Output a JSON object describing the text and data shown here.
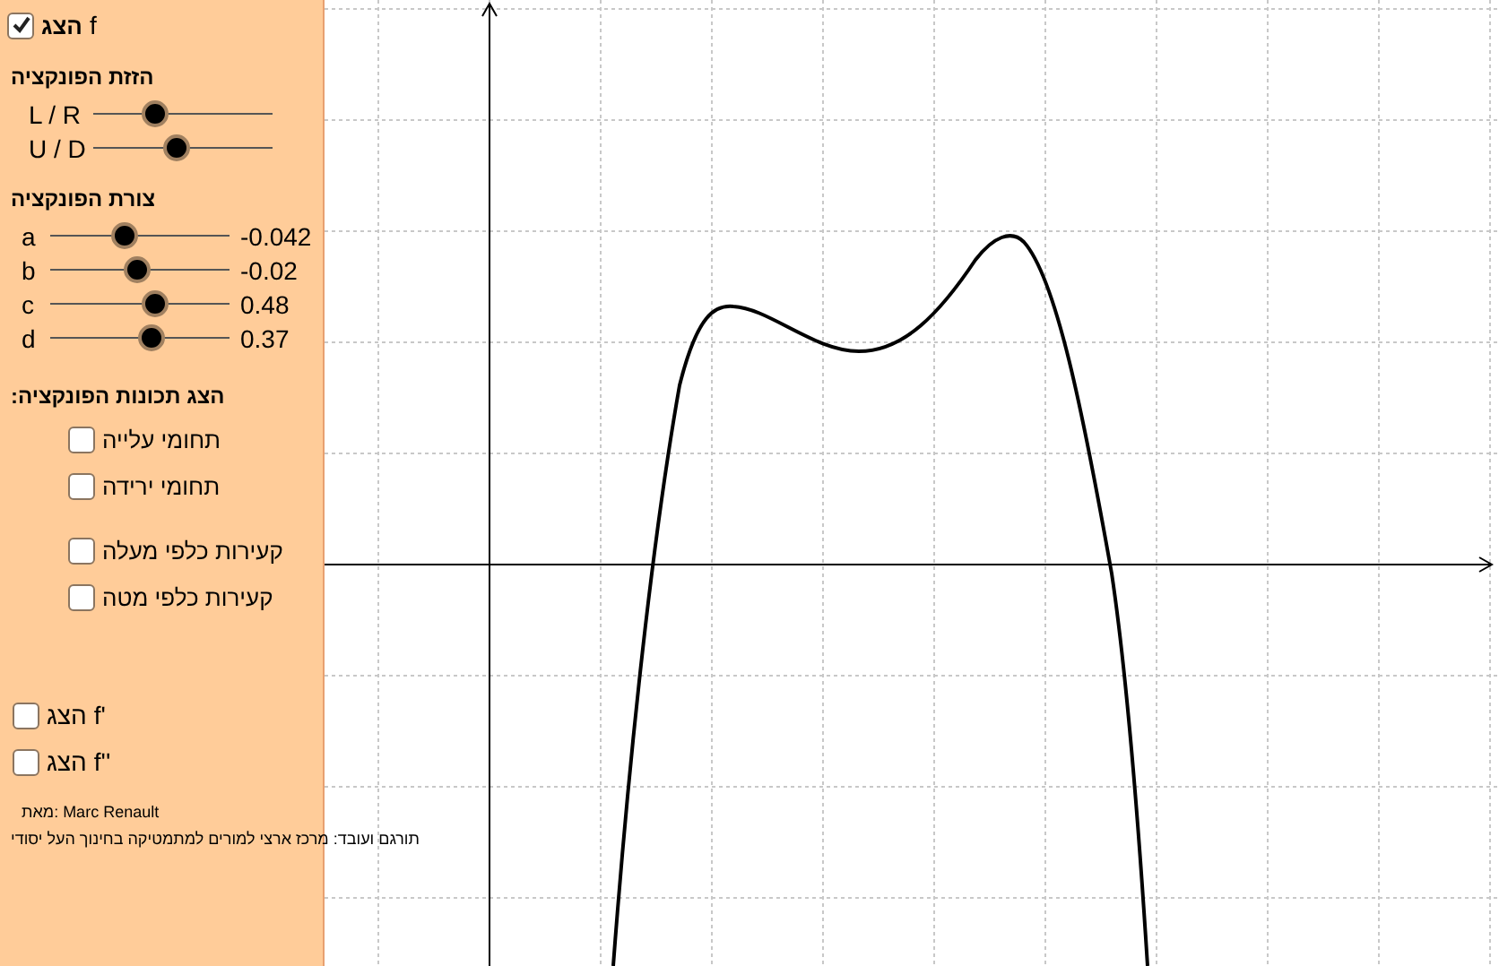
{
  "show_f": {
    "label": "הצג",
    "function": "f",
    "checked": true
  },
  "shift": {
    "title": "הזזת הפונקציה",
    "sliders": [
      {
        "label": "L / R",
        "level": 0.34
      },
      {
        "label": "U / D",
        "level": 0.46
      }
    ]
  },
  "shape": {
    "title": "צורת הפונקציה",
    "sliders": [
      {
        "label": "a",
        "level": 0.41,
        "reading": "-0.042"
      },
      {
        "label": "b",
        "level": 0.48,
        "reading": "-0.02"
      },
      {
        "label": "c",
        "level": 0.58,
        "reading": "0.48"
      },
      {
        "label": "d",
        "level": 0.56,
        "reading": "0.37"
      }
    ]
  },
  "properties": {
    "title": "הצג תכונות הפונקציה:",
    "options": [
      {
        "label": "תחומי עלייה",
        "checked": false
      },
      {
        "label": "תחומי ירידה",
        "checked": false
      },
      {
        "label": "קעירות כלפי מעלה",
        "checked": false
      },
      {
        "label": "קעירות כלפי מטה",
        "checked": false
      }
    ]
  },
  "derivatives": [
    {
      "label": "הצג",
      "function": "f'",
      "checked": false
    },
    {
      "label": "הצג",
      "function": "f''",
      "checked": false
    }
  ],
  "credits": [
    "מאת: Marc Renault",
    "תורגם ועובד: מרכז ארצי למורים למתמטיקה בחינוך העל יסודי"
  ]
}
